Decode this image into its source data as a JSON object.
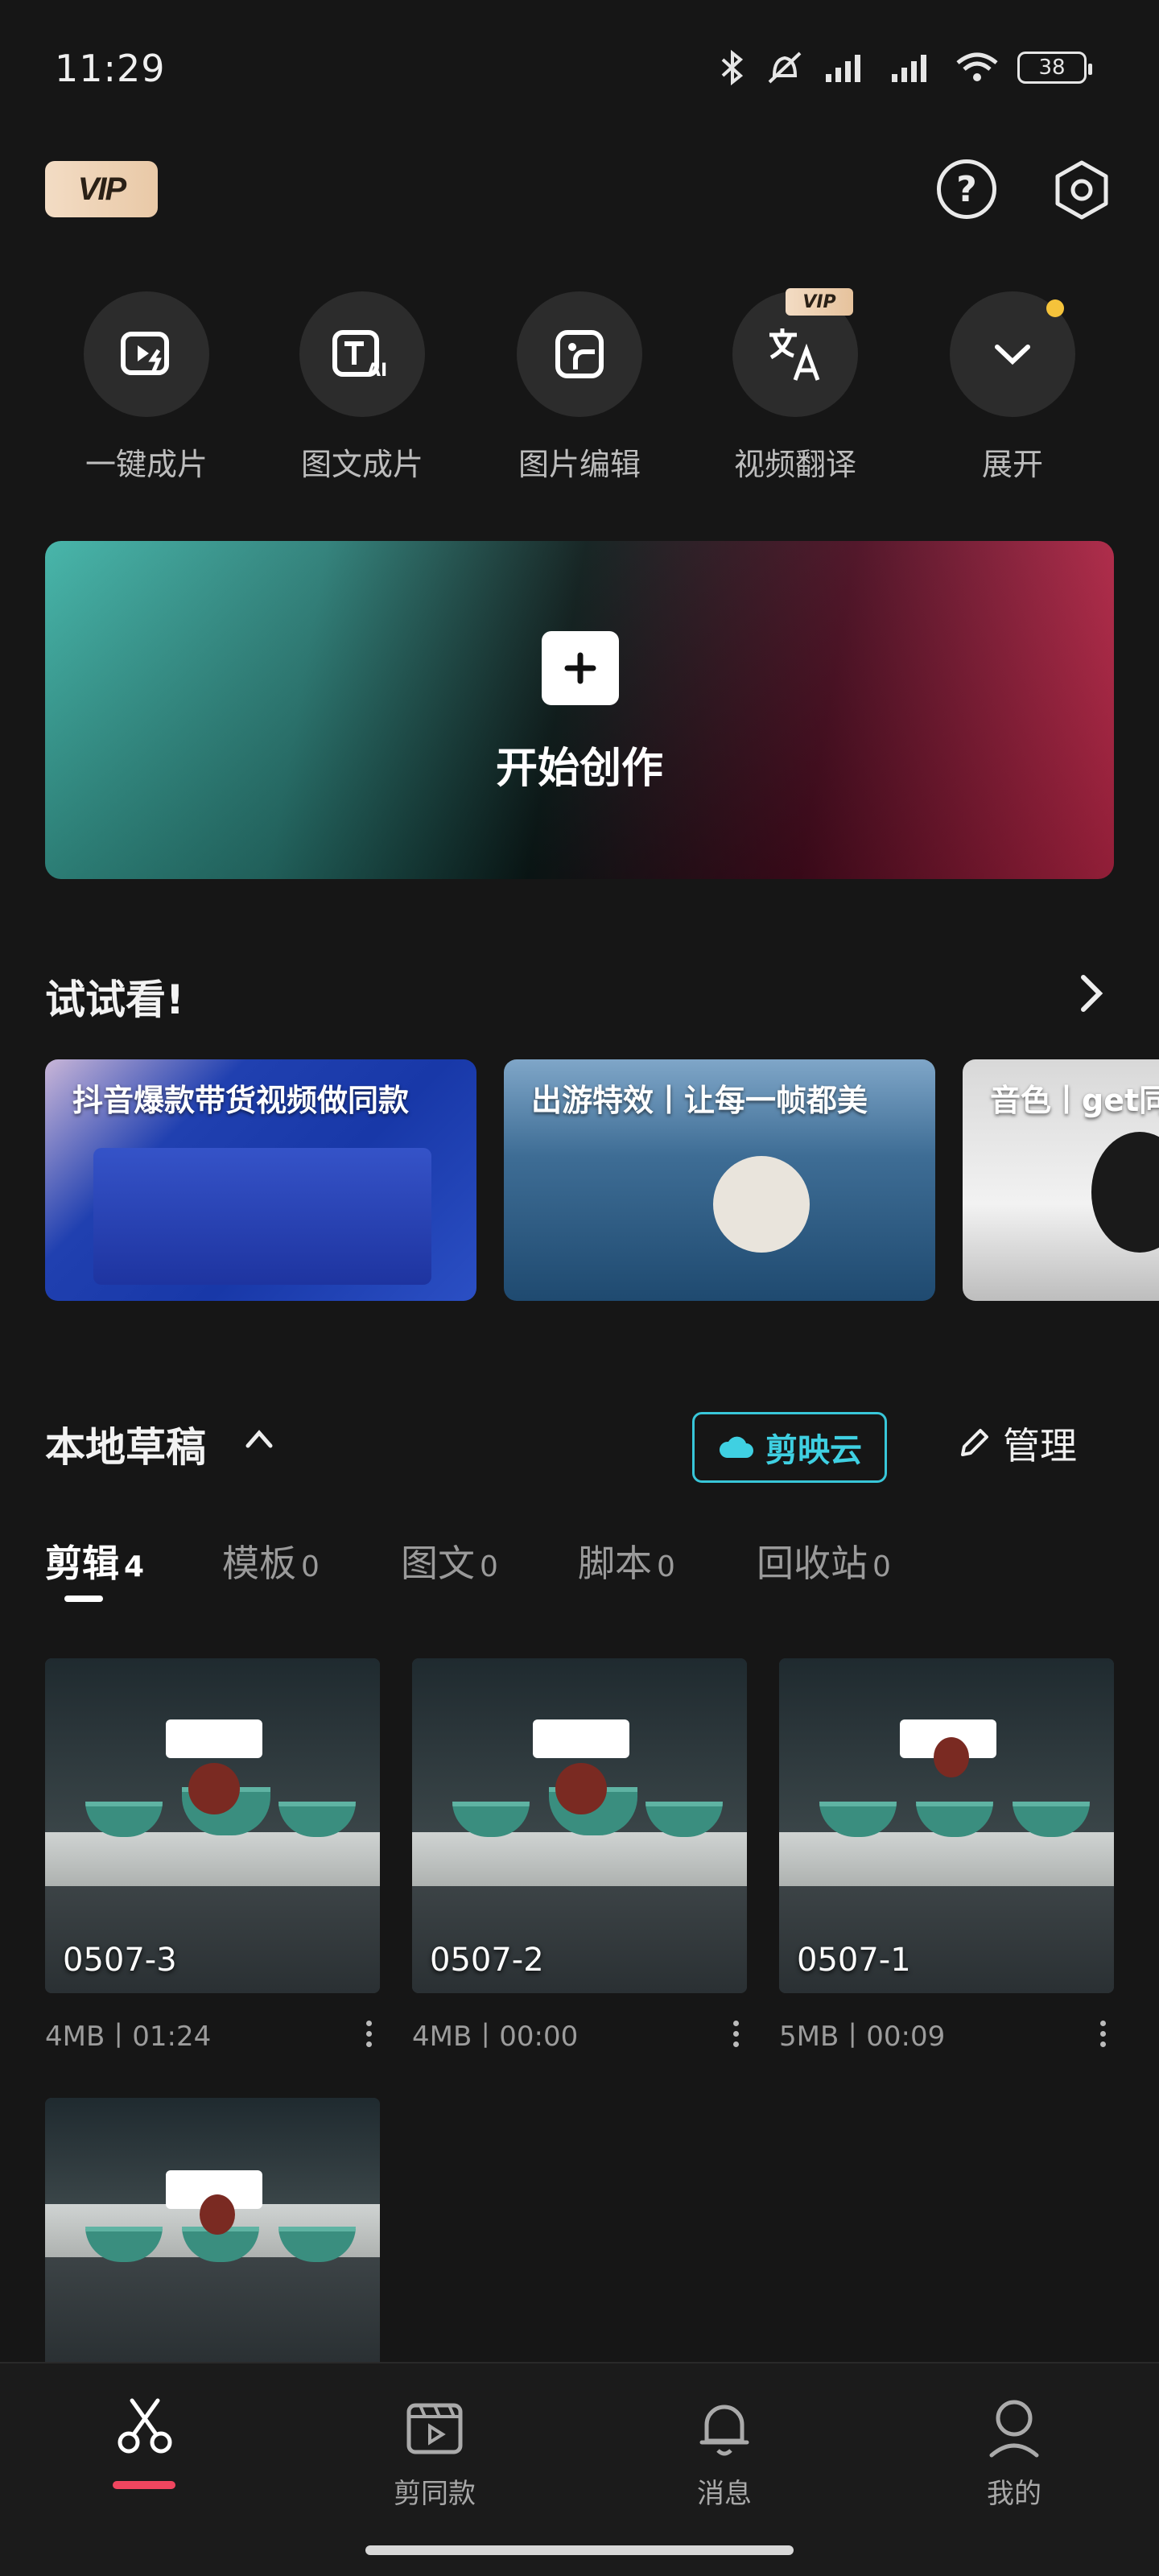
{
  "status_bar": {
    "time": "11:29",
    "battery": "38"
  },
  "header": {
    "vip_label": "VIP"
  },
  "tools": [
    {
      "label": "一键成片",
      "icon": "auto-cut-icon"
    },
    {
      "label": "图文成片",
      "icon": "text-to-video-icon"
    },
    {
      "label": "图片编辑",
      "icon": "image-edit-icon"
    },
    {
      "label": "视频翻译",
      "icon": "translate-icon",
      "badge": "VIP"
    },
    {
      "label": "展开",
      "icon": "chevron-down-icon"
    }
  ],
  "create": {
    "label": "开始创作"
  },
  "try_section": {
    "title": "试试看!",
    "cards": [
      {
        "caption": "抖音爆款带货视频做同款"
      },
      {
        "caption": "出游特效丨让每一帧都美"
      },
      {
        "caption": "音色丨get同"
      }
    ]
  },
  "drafts": {
    "title": "本地草稿",
    "cloud_label": "剪映云",
    "manage_label": "管理",
    "tabs": [
      {
        "label": "剪辑",
        "count": "4"
      },
      {
        "label": "模板",
        "count": "0"
      },
      {
        "label": "图文",
        "count": "0"
      },
      {
        "label": "脚本",
        "count": "0"
      },
      {
        "label": "回收站",
        "count": "0"
      }
    ],
    "items": [
      {
        "name": "0507-3",
        "meta": "4MB丨01:24"
      },
      {
        "name": "0507-2",
        "meta": "4MB丨00:00"
      },
      {
        "name": "0507-1",
        "meta": "5MB丨00:09"
      },
      {
        "name": "",
        "meta": ""
      }
    ]
  },
  "bottom_nav": [
    {
      "label": "",
      "icon": "scissors-icon"
    },
    {
      "label": "剪同款",
      "icon": "template-icon"
    },
    {
      "label": "消息",
      "icon": "bell-icon"
    },
    {
      "label": "我的",
      "icon": "profile-icon"
    }
  ],
  "colors": {
    "accent_cyan": "#38c6d9",
    "accent_red": "#f0455f",
    "vip_gold": "#f3dcc4"
  }
}
